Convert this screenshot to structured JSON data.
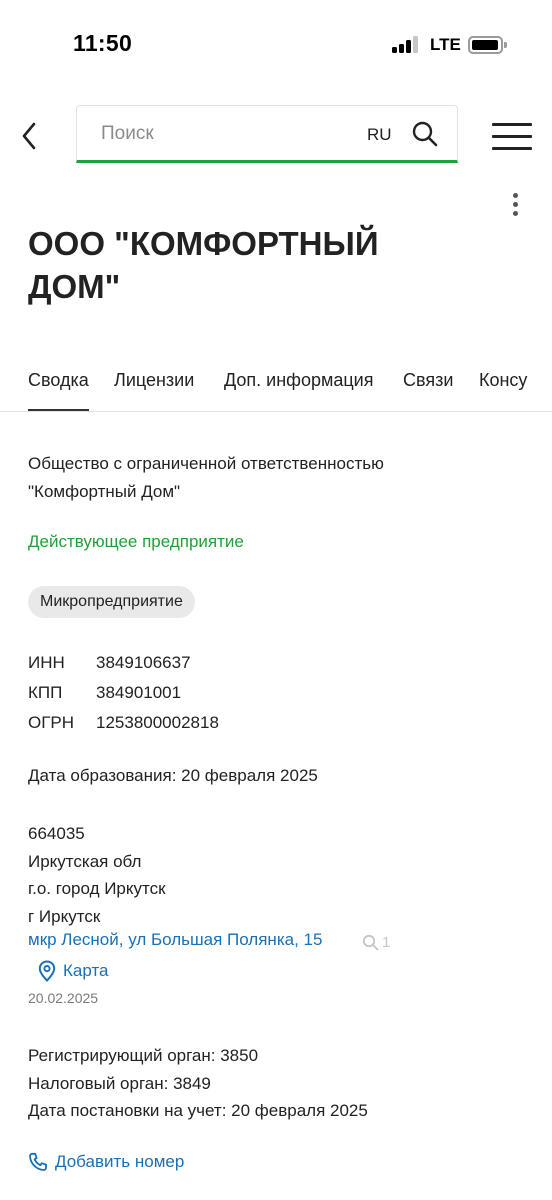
{
  "status_bar": {
    "time": "11:50",
    "network": "LTE",
    "signal_bars_filled": 3,
    "signal_bars_total": 4
  },
  "header": {
    "search_placeholder": "Поиск",
    "language": "RU",
    "back_icon": "chevron-left-icon",
    "search_icon": "search-icon",
    "menu_icon": "hamburger-icon",
    "accent_color": "#21a038"
  },
  "company": {
    "title_line1": "ООО \"КОМФОРТНЫЙ",
    "title_line2": "ДОМ\""
  },
  "tabs": [
    {
      "label": "Сводка",
      "active": true
    },
    {
      "label": "Лицензии",
      "active": false
    },
    {
      "label": "Доп. информация",
      "active": false
    },
    {
      "label": "Связи",
      "active": false
    },
    {
      "label": "Консу",
      "active": false
    }
  ],
  "summary": {
    "full_name_line1": "Общество с ограниченной ответственностью",
    "full_name_line2": "\"Комфортный Дом\"",
    "status": "Действующее предприятие",
    "status_color": "#21a038",
    "size_category": "Микропредприятие",
    "codes": [
      {
        "label": "ИНН",
        "value": "3849106637"
      },
      {
        "label": "КПП",
        "value": "384901001"
      },
      {
        "label": "ОГРН",
        "value": "1253800002818"
      }
    ],
    "registration_date": "Дата образования: 20 февраля 2025",
    "address": {
      "postal_code": "664035",
      "region": "Иркутская обл",
      "district": "г.о. город Иркутск",
      "city": "г Иркутск",
      "street_link": "мкр Лесной, ул Большая Полянка, 15",
      "search_count": "1",
      "map_label": "Карта",
      "date": "20.02.2025",
      "link_color": "#1a6fb5"
    },
    "registering_authority": "Регистрирующий орган: 3850",
    "tax_authority": "Налоговый орган: 3849",
    "tax_registration_date": "Дата постановки на учет: 20 февраля 2025",
    "add_phone_label": "Добавить номер"
  }
}
